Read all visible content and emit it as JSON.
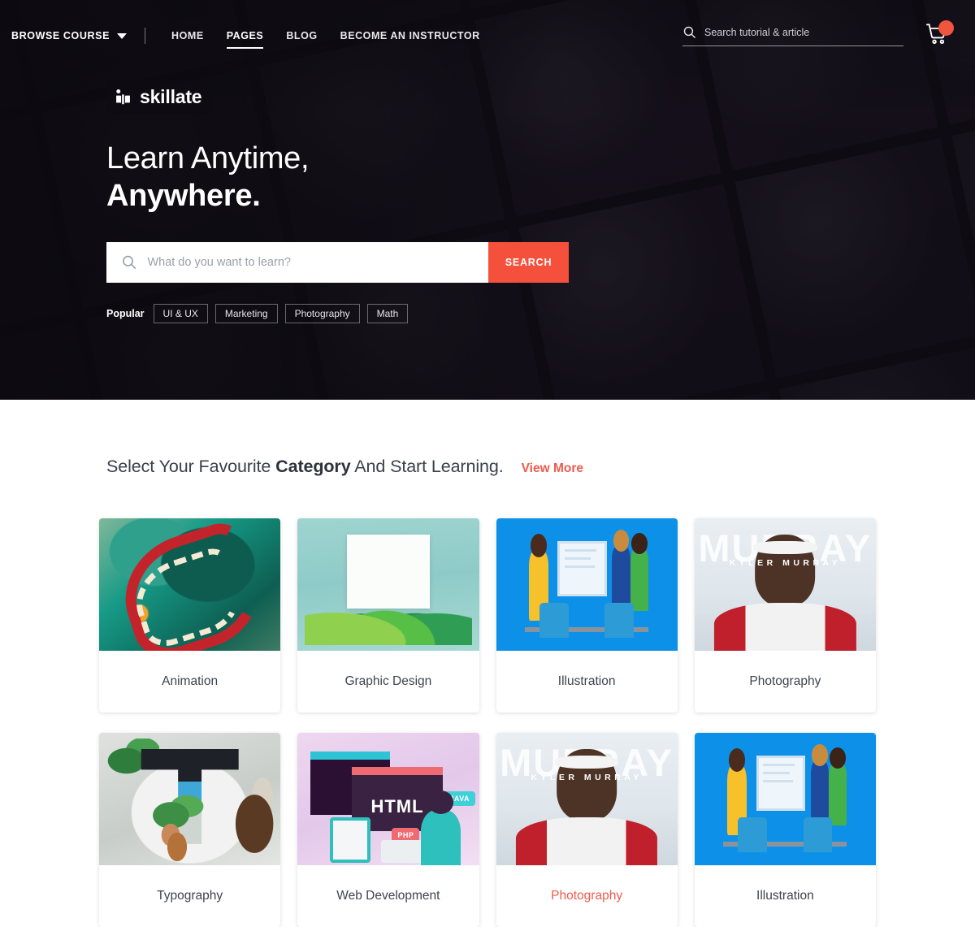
{
  "navbar": {
    "browse_course": "BROWSE COURSE",
    "links": [
      {
        "label": "HOME",
        "active": false
      },
      {
        "label": "PAGES",
        "active": true
      },
      {
        "label": "BLOG",
        "active": false
      },
      {
        "label": "BECOME AN INSTRUCTOR",
        "active": false
      }
    ],
    "search_placeholder": "Search tutorial & article",
    "search_value": "",
    "cart_icon": "shopping-cart-icon",
    "cart_badge": ""
  },
  "hero": {
    "logo_text": "skillate",
    "logo_icon": "open-book-icon",
    "title_line1": "Learn Anytime,",
    "title_line2": "Anywhere.",
    "search_placeholder": "What do you want to learn?",
    "search_value": "",
    "search_button": "SEARCH",
    "popular_label": "Popular",
    "popular_tags": [
      "UI & UX",
      "Marketing",
      "Photography",
      "Math"
    ]
  },
  "category_section": {
    "title_prefix": "Select Your Favourite ",
    "title_bold": "Category",
    "title_suffix": " And Start Learning.",
    "view_more": "View More",
    "cards": [
      {
        "label": "Animation",
        "art": "art-animation",
        "highlight": false
      },
      {
        "label": "Graphic Design",
        "art": "art-graphic",
        "highlight": false
      },
      {
        "label": "Illustration",
        "art": "art-illustration",
        "highlight": false
      },
      {
        "label": "Photography",
        "art": "art-photo",
        "highlight": false
      },
      {
        "label": "Typography",
        "art": "art-typography",
        "highlight": false
      },
      {
        "label": "Web Development",
        "art": "art-webdev",
        "highlight": false
      },
      {
        "label": "Photography",
        "art": "art-photo",
        "highlight": true
      },
      {
        "label": "Illustration",
        "art": "art-illustration",
        "highlight": false
      }
    ],
    "photo_art": {
      "big_text": "MURRAY",
      "small_text": "KYLER       MURRAY"
    },
    "webdev_art": {
      "window_text": "HTML",
      "java_tag": "JAVA",
      "php_tag": "PHP"
    }
  },
  "colors": {
    "accent": "#f4503c",
    "link": "#ef5b4c",
    "hero_bg": "#100d14",
    "text_dark": "#3d444e"
  }
}
